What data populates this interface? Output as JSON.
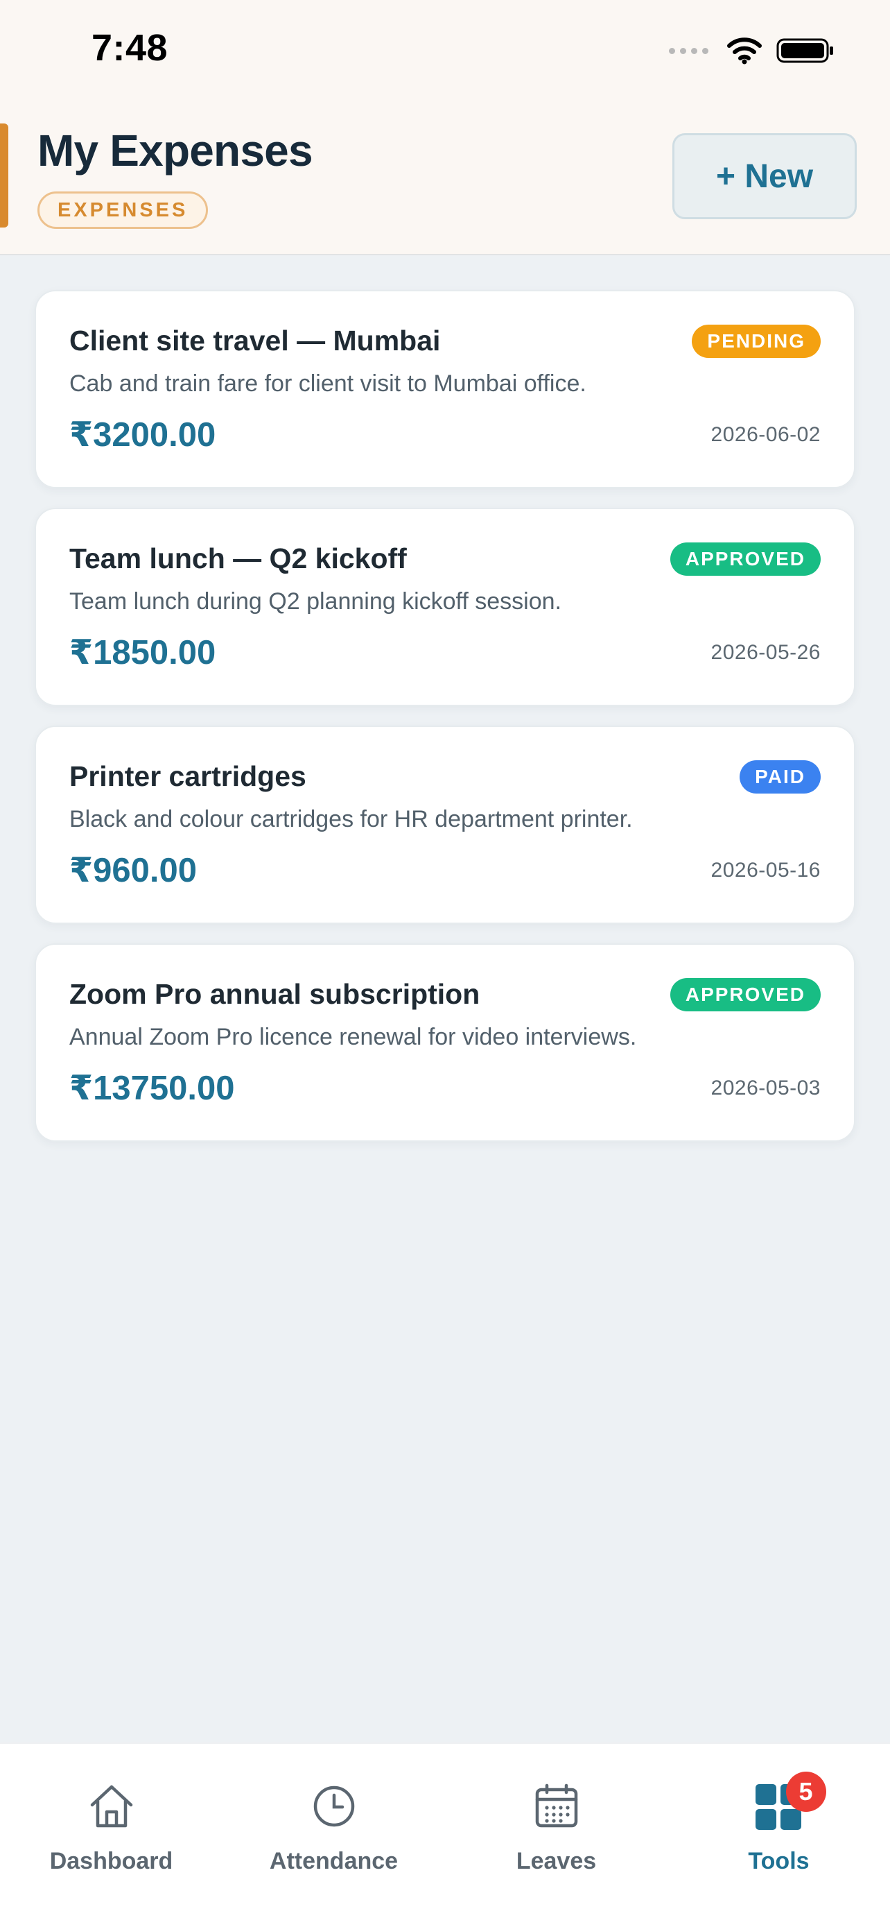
{
  "status_bar": {
    "time": "7:48"
  },
  "header": {
    "title": "My Expenses",
    "section_badge": "EXPENSES",
    "new_button": "+ New"
  },
  "expenses": [
    {
      "title": "Client site travel — Mumbai",
      "description": "Cab and train fare for client visit to Mumbai office.",
      "amount": "₹3200.00",
      "date": "2026-06-02",
      "status": "PENDING",
      "status_color": "#f4a111"
    },
    {
      "title": "Team lunch — Q2 kickoff",
      "description": "Team lunch during Q2 planning kickoff session.",
      "amount": "₹1850.00",
      "date": "2026-05-26",
      "status": "APPROVED",
      "status_color": "#18bd84"
    },
    {
      "title": "Printer cartridges",
      "description": "Black and colour cartridges for HR department printer.",
      "amount": "₹960.00",
      "date": "2026-05-16",
      "status": "PAID",
      "status_color": "#3b82f0"
    },
    {
      "title": "Zoom Pro annual subscription",
      "description": "Annual Zoom Pro licence renewal for video interviews.",
      "amount": "₹13750.00",
      "date": "2026-05-03",
      "status": "APPROVED",
      "status_color": "#18bd84"
    }
  ],
  "bottom_nav": {
    "items": [
      {
        "label": "Dashboard",
        "icon": "home-icon"
      },
      {
        "label": "Attendance",
        "icon": "clock-icon"
      },
      {
        "label": "Leaves",
        "icon": "calendar-icon"
      },
      {
        "label": "Tools",
        "icon": "grid-icon",
        "badge": "5",
        "active": true
      }
    ]
  },
  "colors": {
    "accent": "#1f7193",
    "header_bg": "#fbf7f3",
    "section_badge": "#d68a2f",
    "badge_red": "#ec3c34"
  }
}
